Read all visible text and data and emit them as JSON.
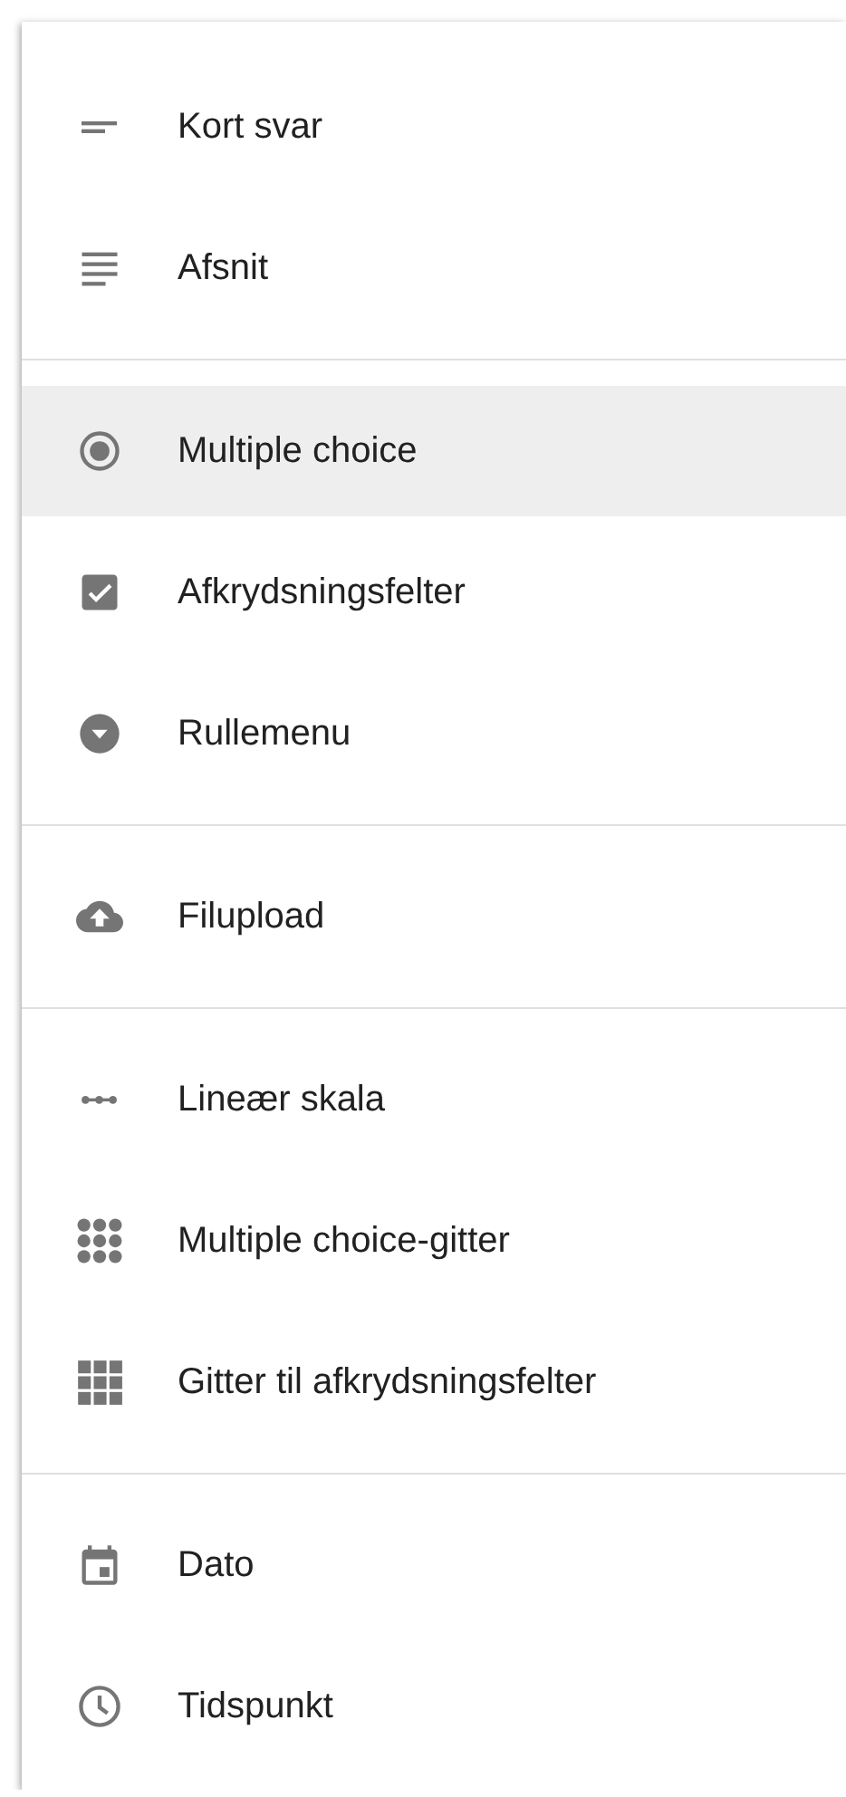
{
  "menu": {
    "groups": [
      {
        "items": [
          {
            "label": "Kort svar",
            "kind": "short",
            "selected": false
          },
          {
            "label": "Afsnit",
            "kind": "paragraph",
            "selected": false
          }
        ]
      },
      {
        "items": [
          {
            "label": "Multiple choice",
            "kind": "radio",
            "selected": true
          },
          {
            "label": "Afkrydsningsfelter",
            "kind": "checkbox",
            "selected": false
          },
          {
            "label": "Rullemenu",
            "kind": "dropdown",
            "selected": false
          }
        ]
      },
      {
        "items": [
          {
            "label": "Filupload",
            "kind": "upload",
            "selected": false
          }
        ]
      },
      {
        "items": [
          {
            "label": "Lineær skala",
            "kind": "scale",
            "selected": false
          },
          {
            "label": "Multiple choice-gitter",
            "kind": "dotgrid",
            "selected": false
          },
          {
            "label": "Gitter til afkrydsningsfelter",
            "kind": "boxgrid",
            "selected": false
          }
        ]
      },
      {
        "items": [
          {
            "label": "Dato",
            "kind": "date",
            "selected": false
          },
          {
            "label": "Tidspunkt",
            "kind": "time",
            "selected": false
          }
        ]
      }
    ]
  }
}
